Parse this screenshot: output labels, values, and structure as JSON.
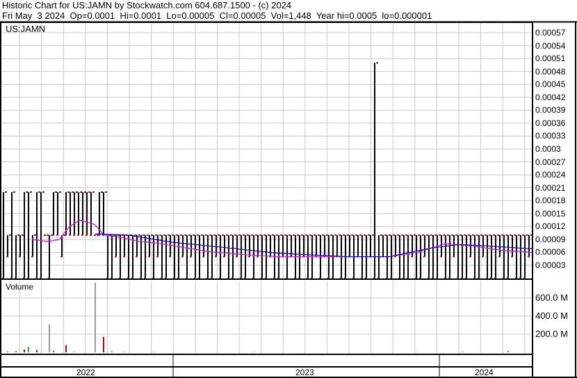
{
  "header": {
    "title": "Historic Chart for US:JAMN by Stockwatch.com 604.687.1500 - (c) 2024",
    "quote": "Fri May  3 2024  Op=0.0001  Hi=0.0001  Lo=0.00005  Cl=0.00005  Vol=1,448  Year hi=0.0005  lo=0.000001"
  },
  "chart_data": {
    "type": "bar",
    "symbol": "US:JAMN",
    "volume_title": "Volume",
    "price_ticks": [
      "0.00057",
      "0.00054",
      "0.00051",
      "0.00048",
      "0.00045",
      "0.00042",
      "0.00039",
      "0.00036",
      "0.00033",
      "0.0003",
      "0.00027",
      "0.00024",
      "0.00021",
      "0.00018",
      "0.00015",
      "0.00012",
      "0.00009",
      "0.00006",
      "0.00003"
    ],
    "volume_ticks": [
      "600.0 M",
      "400.0 M",
      "200.0 M"
    ],
    "years": [
      "2022",
      "2023",
      "2024"
    ],
    "price_unit": 5e-05,
    "bar_highs": [
      4,
      2,
      4,
      2,
      2,
      4,
      4,
      2,
      4,
      4,
      2,
      2,
      4,
      4,
      2,
      4,
      4,
      4,
      4,
      4,
      4,
      4,
      2,
      4,
      4,
      2,
      2,
      2,
      2,
      2,
      2,
      2,
      2,
      2,
      2,
      2,
      2,
      2,
      2,
      2,
      2,
      2,
      2,
      2,
      2,
      2,
      2,
      2,
      2,
      2,
      2,
      2,
      2,
      2,
      2,
      2,
      2,
      2,
      2,
      2,
      2,
      2,
      2,
      2,
      2,
      2,
      2,
      2,
      2,
      2,
      2,
      2,
      2,
      2,
      2,
      2,
      2,
      2,
      2,
      2,
      2,
      2,
      2,
      2,
      2,
      2,
      2,
      2,
      2,
      10,
      2,
      2,
      2,
      2,
      2,
      2,
      2,
      2,
      2,
      2,
      2,
      2,
      2,
      2,
      2,
      2,
      2,
      2,
      2,
      2,
      2,
      2,
      2,
      2,
      2,
      2,
      2,
      2,
      2,
      2,
      2,
      2,
      2,
      2,
      2,
      2,
      2
    ],
    "bar_lows": [
      0,
      1,
      0,
      0,
      1,
      0,
      0,
      1,
      0,
      0,
      2,
      0,
      2,
      2,
      1,
      2,
      2,
      2,
      2,
      2,
      2,
      2,
      2,
      2,
      2,
      0,
      0,
      1,
      0,
      1,
      0,
      0,
      1,
      0,
      0,
      1,
      0,
      1,
      0,
      0,
      1,
      0,
      0,
      1,
      0,
      1,
      0,
      0,
      1,
      0,
      0,
      1,
      0,
      1,
      0,
      0,
      1,
      0,
      0,
      1,
      0,
      1,
      0,
      0,
      1,
      0,
      0,
      1,
      0,
      1,
      0,
      0,
      1,
      0,
      0,
      1,
      0,
      1,
      0,
      0,
      1,
      0,
      0,
      1,
      0,
      1,
      0,
      0,
      1,
      0,
      0,
      1,
      0,
      0,
      1,
      0,
      0,
      0,
      1,
      0,
      0,
      1,
      0,
      0,
      0,
      1,
      0,
      0,
      1,
      0,
      0,
      0,
      1,
      0,
      0,
      1,
      0,
      0,
      0,
      1,
      0,
      0,
      1,
      0,
      0,
      0,
      1
    ],
    "ma_short": [
      [
        7,
        9e-05
      ],
      [
        11,
        8.5e-05
      ],
      [
        13.5,
        9e-05
      ],
      [
        16,
        0.00012
      ],
      [
        18.5,
        0.000135
      ],
      [
        22,
        0.000125
      ],
      [
        24.3,
        0.0001
      ],
      [
        28.5,
        9.5e-05
      ],
      [
        32.7,
        8.5e-05
      ],
      [
        36,
        8.3e-05
      ],
      [
        41,
        7.5e-05
      ],
      [
        49.3,
        6.2e-05
      ],
      [
        57.7,
        5.5e-05
      ],
      [
        66,
        5e-05
      ],
      [
        74.3,
        5e-05
      ],
      [
        82.7,
        5e-05
      ],
      [
        89.3,
        5e-05
      ],
      [
        92.7,
        5e-05
      ],
      [
        99.3,
        6e-05
      ],
      [
        106,
        8e-05
      ],
      [
        112.7,
        7.5e-05
      ],
      [
        119.3,
        6.5e-05
      ],
      [
        127,
        6e-05
      ]
    ],
    "ma_long": [
      [
        22.2,
        0.000103
      ],
      [
        30,
        0.0001
      ],
      [
        41,
        8.3e-05
      ],
      [
        49.3,
        7.5e-05
      ],
      [
        66,
        5.8e-05
      ],
      [
        82.7,
        5e-05
      ],
      [
        92.7,
        5e-05
      ],
      [
        102.7,
        7e-05
      ],
      [
        109.3,
        7.8e-05
      ],
      [
        116,
        7.5e-05
      ],
      [
        127,
        6.8e-05
      ]
    ],
    "volume_m": [
      [
        1,
        10,
        "#3a3"
      ],
      [
        3,
        15,
        "#3a3"
      ],
      [
        5,
        30,
        "#c00"
      ],
      [
        6,
        60,
        "#3a3"
      ],
      [
        8,
        25,
        "#c00"
      ],
      [
        11,
        310,
        "#999"
      ],
      [
        12,
        20,
        "#3a3"
      ],
      [
        15,
        80,
        "#c00"
      ],
      [
        17,
        10,
        "#999"
      ],
      [
        22,
        770,
        "#999"
      ],
      [
        24,
        170,
        "#c00"
      ],
      [
        26,
        15,
        "#999"
      ],
      [
        29,
        8,
        "#999"
      ],
      [
        36,
        5,
        "#3a3"
      ],
      [
        60,
        4,
        "#999"
      ],
      [
        99,
        4,
        "#999"
      ],
      [
        110,
        6,
        "#3a3"
      ],
      [
        121,
        18,
        "#3a3"
      ]
    ]
  }
}
